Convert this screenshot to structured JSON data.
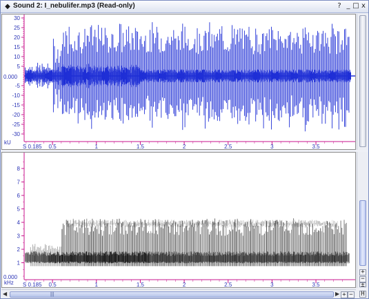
{
  "window": {
    "title": "Sound 2: I_nebulifer.mp3 (Read-only)",
    "buttons": [
      "?",
      "_",
      "□",
      "x"
    ]
  },
  "waveform": {
    "unit_label": "kU",
    "zero_label": "0.000",
    "y_ticks": [
      "30",
      "25",
      "20",
      "15",
      "10",
      "5",
      "-5",
      "-10",
      "-15",
      "-20",
      "-25",
      "-30"
    ],
    "y_values": [
      30,
      25,
      20,
      15,
      10,
      5,
      -5,
      -10,
      -15,
      -20,
      -25,
      -30
    ],
    "x_start_label": "S 0.185",
    "x_ticks": [
      "0.5",
      "1",
      "1.5",
      "2",
      "2.5",
      "3",
      "3.5"
    ],
    "x_values": [
      0.5,
      1,
      1.5,
      2,
      2.5,
      3,
      3.5
    ],
    "color": "#1f2fd6"
  },
  "spectrogram": {
    "unit_label": "kHz",
    "zero_label": "0.000",
    "y_ticks": [
      "8",
      "7",
      "6",
      "5",
      "4",
      "3",
      "2",
      "1"
    ],
    "y_values": [
      8,
      7,
      6,
      5,
      4,
      3,
      2,
      1
    ],
    "x_start_label": "S 0.185",
    "x_ticks": [
      "0.5",
      "1",
      "1.5",
      "2",
      "2.5",
      "3",
      "3.5"
    ],
    "x_values": [
      0.5,
      1,
      1.5,
      2,
      2.5,
      3,
      3.5
    ]
  },
  "zoom_buttons": {
    "in": "+",
    "out": "−",
    "fit": "±"
  },
  "hscroll": {
    "buttons": [
      "+",
      "−",
      "H"
    ]
  },
  "colors": {
    "axis": "#c8148c",
    "tick_label": "#2b34b6",
    "frame": "#8b8b8b"
  }
}
